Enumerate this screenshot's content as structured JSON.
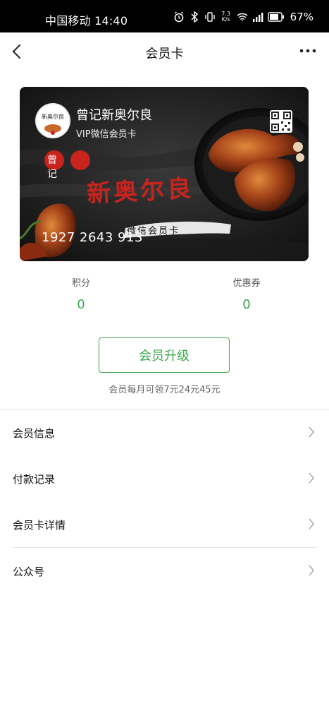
{
  "status_bar": {
    "carrier_time": "中国移动 14:40",
    "speed_value": "7.3",
    "speed_unit": "K/s",
    "battery": "67%",
    "icons": [
      "alarm-icon",
      "bluetooth-icon",
      "vibrate-icon",
      "wifi-icon",
      "signal-icon",
      "battery-icon"
    ]
  },
  "nav": {
    "title": "会员卡",
    "back_icon": "chevron-left-icon",
    "more_icon": "more-icon"
  },
  "card": {
    "store_name": "曾记新奥尔良",
    "card_type": "VIP微信会员卡",
    "logo_text": "新奥尔良",
    "card_number": "1927 2643 913",
    "banner_small": "曾 记",
    "banner_large": "新奥尔良",
    "banner_caption": "微信会员卡",
    "accent_color": "#c8231d"
  },
  "stats": [
    {
      "label": "积分",
      "value": "0"
    },
    {
      "label": "优惠券",
      "value": "0"
    }
  ],
  "upgrade": {
    "button_label": "会员升级",
    "note": "会员每月可领7元24元45元"
  },
  "menu": {
    "items": [
      {
        "label": "会员信息"
      },
      {
        "label": "付款记录"
      },
      {
        "label": "会员卡详情"
      },
      {
        "label": "公众号"
      }
    ]
  },
  "colors": {
    "accent_green": "#3aa64e",
    "status_bar_bg": "#000000"
  }
}
